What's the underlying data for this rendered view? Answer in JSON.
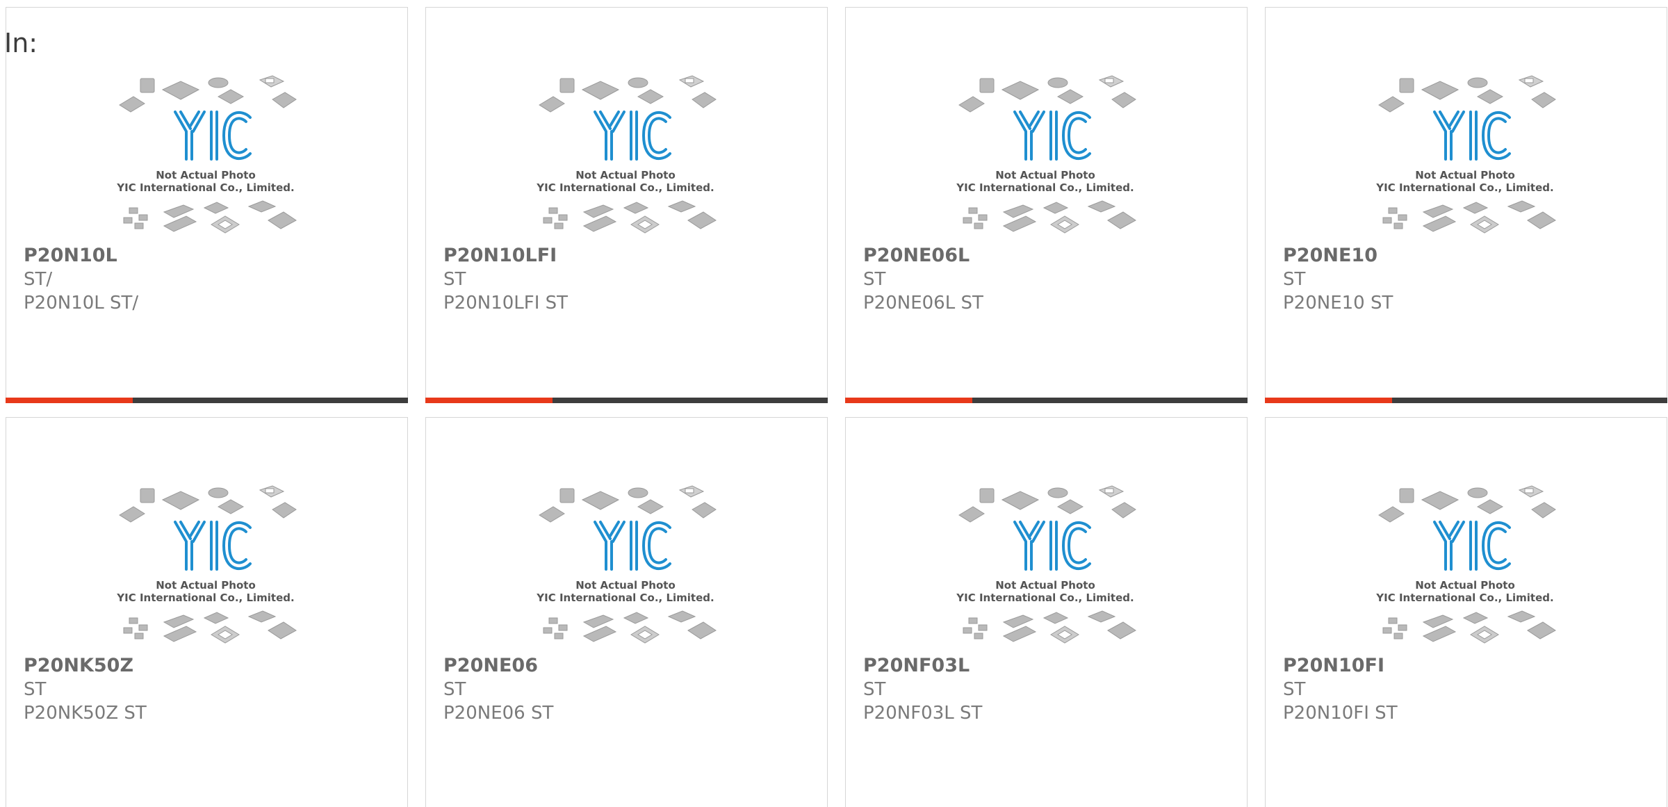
{
  "page": {
    "in_label": "In:"
  },
  "photo": {
    "watermark_line1": "Not Actual Photo",
    "watermark_line2": "YIC International Co., Limited.",
    "logo_text": "YIC"
  },
  "colors": {
    "accent": "#e8391a",
    "bar_dark": "#3d3d3d",
    "logo_blue": "#1f8fd0",
    "chip_gray": "#b7b7b7"
  },
  "products": [
    {
      "part": "P20N10L",
      "maker": "ST/",
      "desc": "P20N10L ST/"
    },
    {
      "part": "P20N10LFI",
      "maker": "ST",
      "desc": "P20N10LFI ST"
    },
    {
      "part": "P20NE06L",
      "maker": "ST",
      "desc": "P20NE06L ST"
    },
    {
      "part": "P20NE10",
      "maker": "ST",
      "desc": "P20NE10 ST"
    },
    {
      "part": "P20NK50Z",
      "maker": "ST",
      "desc": "P20NK50Z ST"
    },
    {
      "part": "P20NE06",
      "maker": "ST",
      "desc": "P20NE06 ST"
    },
    {
      "part": "P20NF03L",
      "maker": "ST",
      "desc": "P20NF03L ST"
    },
    {
      "part": "P20N10FI",
      "maker": "ST",
      "desc": "P20N10FI ST"
    }
  ]
}
